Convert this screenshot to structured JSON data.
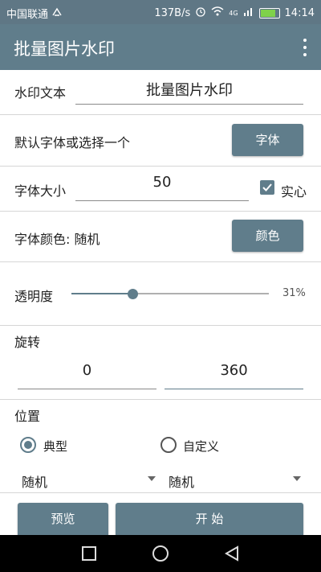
{
  "status_bar": {
    "carrier": "中国联通",
    "speed": "137B/s",
    "network": "4G",
    "time": "14:14"
  },
  "toolbar": {
    "title": "批量图片水印"
  },
  "watermark_text": {
    "label": "水印文本",
    "value": "批量图片水印"
  },
  "font": {
    "label": "默认字体或选择一个",
    "button": "字体"
  },
  "font_size": {
    "label": "字体大小",
    "value": "50",
    "solid_label": "实心",
    "solid_checked": true
  },
  "font_color": {
    "label": "字体颜色: 随机",
    "button": "颜色"
  },
  "opacity": {
    "label": "透明度",
    "value_text": "31%",
    "value": 0.31
  },
  "rotation": {
    "label": "旋转",
    "from": "0",
    "to": "360"
  },
  "position": {
    "label": "位置",
    "option_typical": "典型",
    "option_custom": "自定义",
    "selected": "典型",
    "spinner_left": "随机",
    "spinner_right": "随机"
  },
  "actions": {
    "preview": "预览",
    "start": "开 始"
  },
  "colors": {
    "primary": "#607d8b",
    "status_bar": "#5f7785"
  }
}
